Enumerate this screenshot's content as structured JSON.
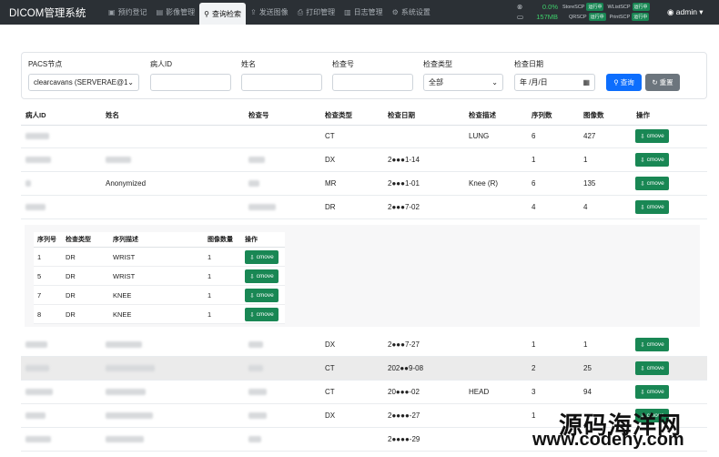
{
  "app": {
    "title": "DICOM管理系统"
  },
  "nav": [
    {
      "icon": "▣",
      "label": "预约登记",
      "active": false
    },
    {
      "icon": "▤",
      "label": "影像管理",
      "active": false
    },
    {
      "icon": "⚲",
      "label": "查询检索",
      "active": true
    },
    {
      "icon": "⇪",
      "label": "发送图像",
      "active": false
    },
    {
      "icon": "⎙",
      "label": "打印管理",
      "active": false
    },
    {
      "icon": "▥",
      "label": "日志管理",
      "active": false
    },
    {
      "icon": "⚙",
      "label": "系统设置",
      "active": false
    }
  ],
  "status": {
    "cpu": "0.0%",
    "mem": "157MB",
    "services": [
      {
        "name": "StoreSCP",
        "state": "运行中"
      },
      {
        "name": "WListSCP",
        "state": "运行中"
      },
      {
        "name": "QRSCP",
        "state": "运行中"
      },
      {
        "name": "PrintSCP",
        "state": "运行中"
      }
    ]
  },
  "user": {
    "name": "admin ▾"
  },
  "filters": {
    "pacs_label": "PACS节点",
    "pacs_value": "clearcavans (SERVERAE@1",
    "patient_id_label": "病人ID",
    "name_label": "姓名",
    "accession_label": "检查号",
    "modality_label": "检查类型",
    "modality_value": "全部",
    "date_label": "检查日期",
    "date_placeholder": "年 /月/日",
    "query_button": "查询",
    "reset_button": "重置"
  },
  "table": {
    "headers": [
      "病人ID",
      "姓名",
      "检查号",
      "检查类型",
      "检查日期",
      "检查描述",
      "序列数",
      "图像数",
      "操作"
    ],
    "rows": [
      {
        "modality": "CT",
        "date": "",
        "desc": "LUNG",
        "series": "6",
        "images": "427",
        "name": ""
      },
      {
        "modality": "DX",
        "date": "2●●●1-14",
        "desc": "",
        "series": "1",
        "images": "1",
        "name": ""
      },
      {
        "modality": "MR",
        "date": "2●●●1-01",
        "desc": "Knee (R)",
        "series": "6",
        "images": "135",
        "name": "Anonymized"
      },
      {
        "modality": "DR",
        "date": "2●●●7-02",
        "desc": "",
        "series": "4",
        "images": "4",
        "name": ""
      },
      {
        "modality": "DX",
        "date": "2●●●7-27",
        "desc": "",
        "series": "1",
        "images": "1",
        "name": ""
      },
      {
        "modality": "CT",
        "date": "202●●9-08",
        "desc": "",
        "series": "2",
        "images": "25",
        "name": ""
      },
      {
        "modality": "CT",
        "date": "20●●●-02",
        "desc": "HEAD",
        "series": "3",
        "images": "94",
        "name": ""
      },
      {
        "modality": "DX",
        "date": "2●●●●-27",
        "desc": "",
        "series": "1",
        "images": "",
        "name": ""
      },
      {
        "modality": "",
        "date": "2●●●●-29",
        "desc": "",
        "series": "",
        "images": "",
        "name": ""
      }
    ],
    "action_label": "cmove"
  },
  "subtable": {
    "headers": [
      "序列号",
      "检查类型",
      "序列描述",
      "图像数量",
      "操作"
    ],
    "rows": [
      {
        "no": "1",
        "modality": "DR",
        "desc": "WRIST",
        "count": "1"
      },
      {
        "no": "5",
        "modality": "DR",
        "desc": "WRIST",
        "count": "1"
      },
      {
        "no": "7",
        "modality": "DR",
        "desc": "KNEE",
        "count": "1"
      },
      {
        "no": "8",
        "modality": "DR",
        "desc": "KNEE",
        "count": "1"
      }
    ],
    "action_label": "cmove"
  },
  "watermark": {
    "line1": "源码海洋网",
    "line2": "www.codehy.com"
  }
}
